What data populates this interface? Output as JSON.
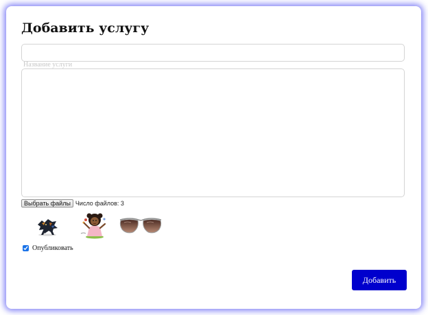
{
  "form": {
    "title": "Добавить услугу",
    "name_field": {
      "value": "",
      "placeholder": "",
      "label": "Название услуги"
    },
    "description_field": {
      "value": ""
    },
    "file_input": {
      "button_label": "Выбрать файлы",
      "status_text": "Число файлов: 3"
    },
    "previews": [
      {
        "icon": "dark-creature-figure-image"
      },
      {
        "icon": "cartoon-girl-with-flowers-image"
      },
      {
        "icon": "aviator-sunglasses-image"
      }
    ],
    "publish": {
      "label": "Опубликовать",
      "checked": true
    },
    "submit_label": "Добавить"
  },
  "colors": {
    "card_glow": "#6e6ef5",
    "submit_background": "#0000cd",
    "submit_text": "#ffffff",
    "label_muted": "#c8c8c8"
  }
}
